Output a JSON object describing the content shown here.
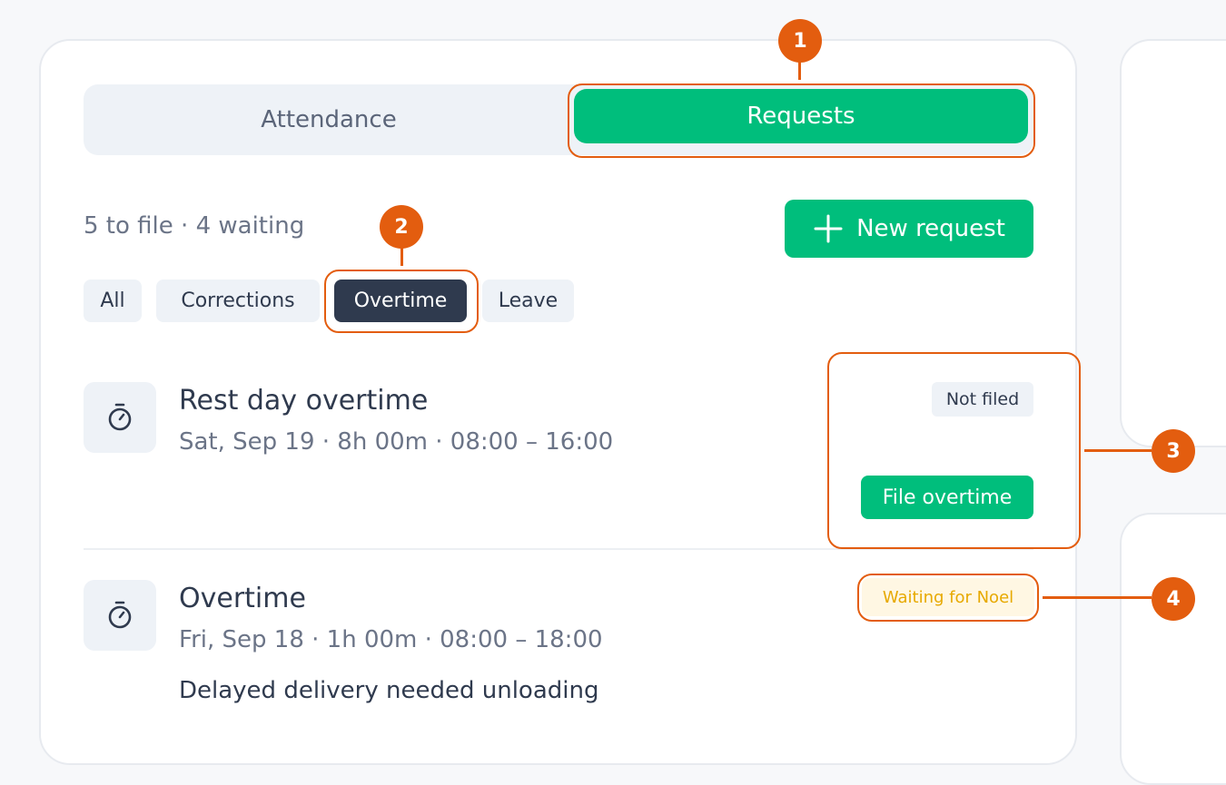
{
  "tabs": [
    {
      "label": "Attendance",
      "active": false
    },
    {
      "label": "Requests",
      "active": true
    }
  ],
  "summary": "5 to file · 4 waiting",
  "new_request_label": "New request",
  "filters": [
    {
      "label": "All",
      "active": false
    },
    {
      "label": "Corrections",
      "active": false
    },
    {
      "label": "Overtime",
      "active": true
    },
    {
      "label": "Leave",
      "active": false
    }
  ],
  "requests": [
    {
      "icon": "stopwatch-icon",
      "title": "Rest day overtime",
      "subtitle": "Sat, Sep 19 · 8h 00m · 08:00 – 16:00",
      "status": "Not filed",
      "action": "File overtime"
    },
    {
      "icon": "stopwatch-icon",
      "title": "Overtime",
      "subtitle": "Fri, Sep 18 · 1h 00m · 08:00 – 18:00",
      "note": "Delayed delivery needed unloading",
      "status": "Waiting for Noel"
    }
  ],
  "annotations": [
    "1",
    "2",
    "3",
    "4"
  ],
  "colors": {
    "accent": "#00be7c",
    "annotation": "#e35d0f",
    "chip_active": "#2f3a4e",
    "waiting_text": "#e7a900",
    "waiting_bg": "#fff7e3"
  }
}
